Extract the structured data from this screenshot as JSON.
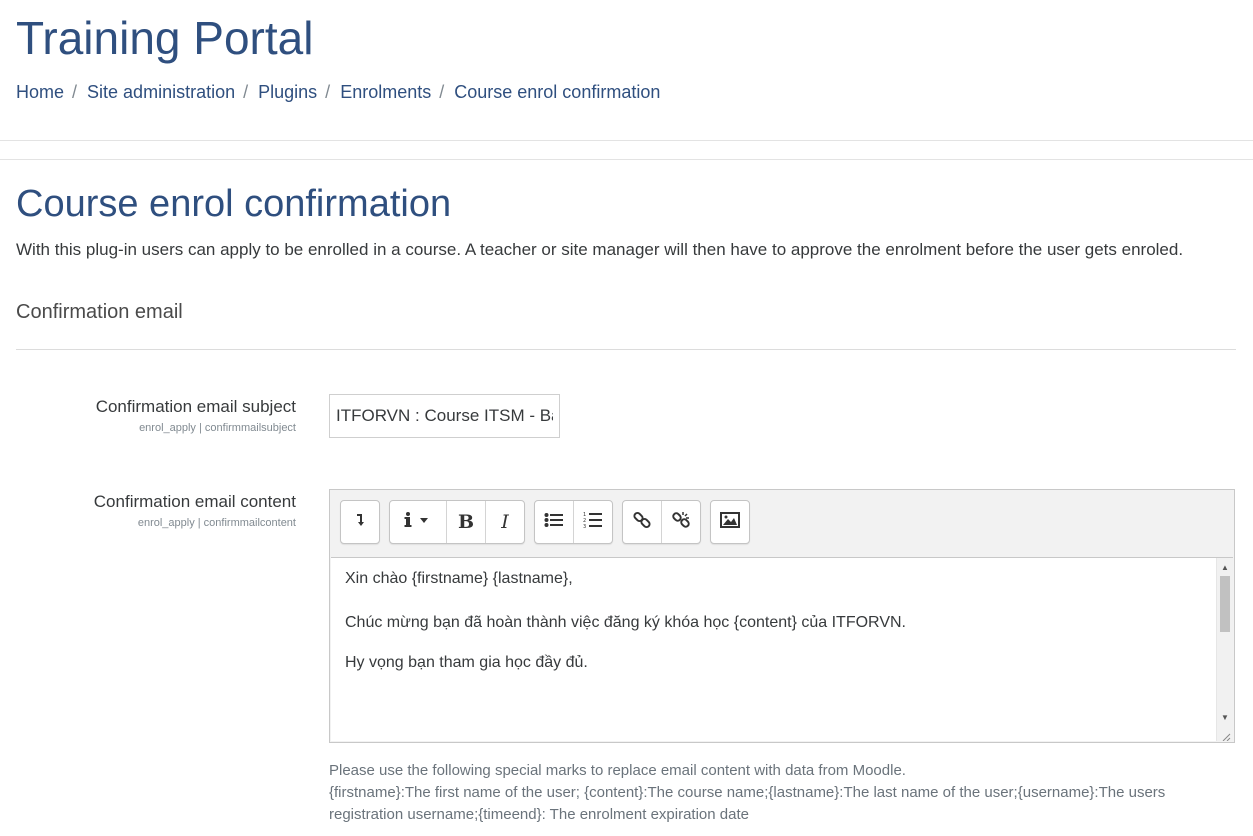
{
  "site": {
    "title": "Training Portal"
  },
  "breadcrumb": {
    "separator": "/",
    "items": [
      {
        "label": "Home"
      },
      {
        "label": "Site administration"
      },
      {
        "label": "Plugins"
      },
      {
        "label": "Enrolments"
      },
      {
        "label": "Course enrol confirmation"
      }
    ]
  },
  "page": {
    "heading": "Course enrol confirmation",
    "description": "With this plug-in users can apply to be enrolled in a course. A teacher or site manager will then have to approve the enrolment before the user gets enroled."
  },
  "section": {
    "heading": "Confirmation email"
  },
  "subject_field": {
    "label": "Confirmation email subject",
    "key": "enrol_apply | confirmmailsubject",
    "value": "ITFORVN : Course ITSM - Basic"
  },
  "content_field": {
    "label": "Confirmation email content",
    "key": "enrol_apply | confirmmailcontent",
    "toolbar": {
      "groups": [
        [
          "collapse-icon"
        ],
        [
          "info-dropdown-icon",
          "bold-icon",
          "italic-icon"
        ],
        [
          "bullet-list-icon",
          "numbered-list-icon"
        ],
        [
          "link-icon",
          "unlink-icon"
        ],
        [
          "image-icon"
        ]
      ]
    },
    "paragraphs": [
      "Xin chào {firstname} {lastname},",
      "",
      "Chúc mừng bạn đã hoàn thành việc đăng ký khóa học {content} của ITFORVN.",
      "Hy vọng bạn tham gia học đầy đủ."
    ]
  },
  "help": {
    "line1": "Please use the following special marks to replace email content with data from Moodle.",
    "line2": "{firstname}:The first name of the user; {content}:The course name;{lastname}:The last name of the user;{username}:The users registration username;{timeend}: The enrolment expiration date"
  },
  "colors": {
    "heading": "#2f4f7f",
    "text": "#373a3c",
    "muted": "#818a91"
  }
}
